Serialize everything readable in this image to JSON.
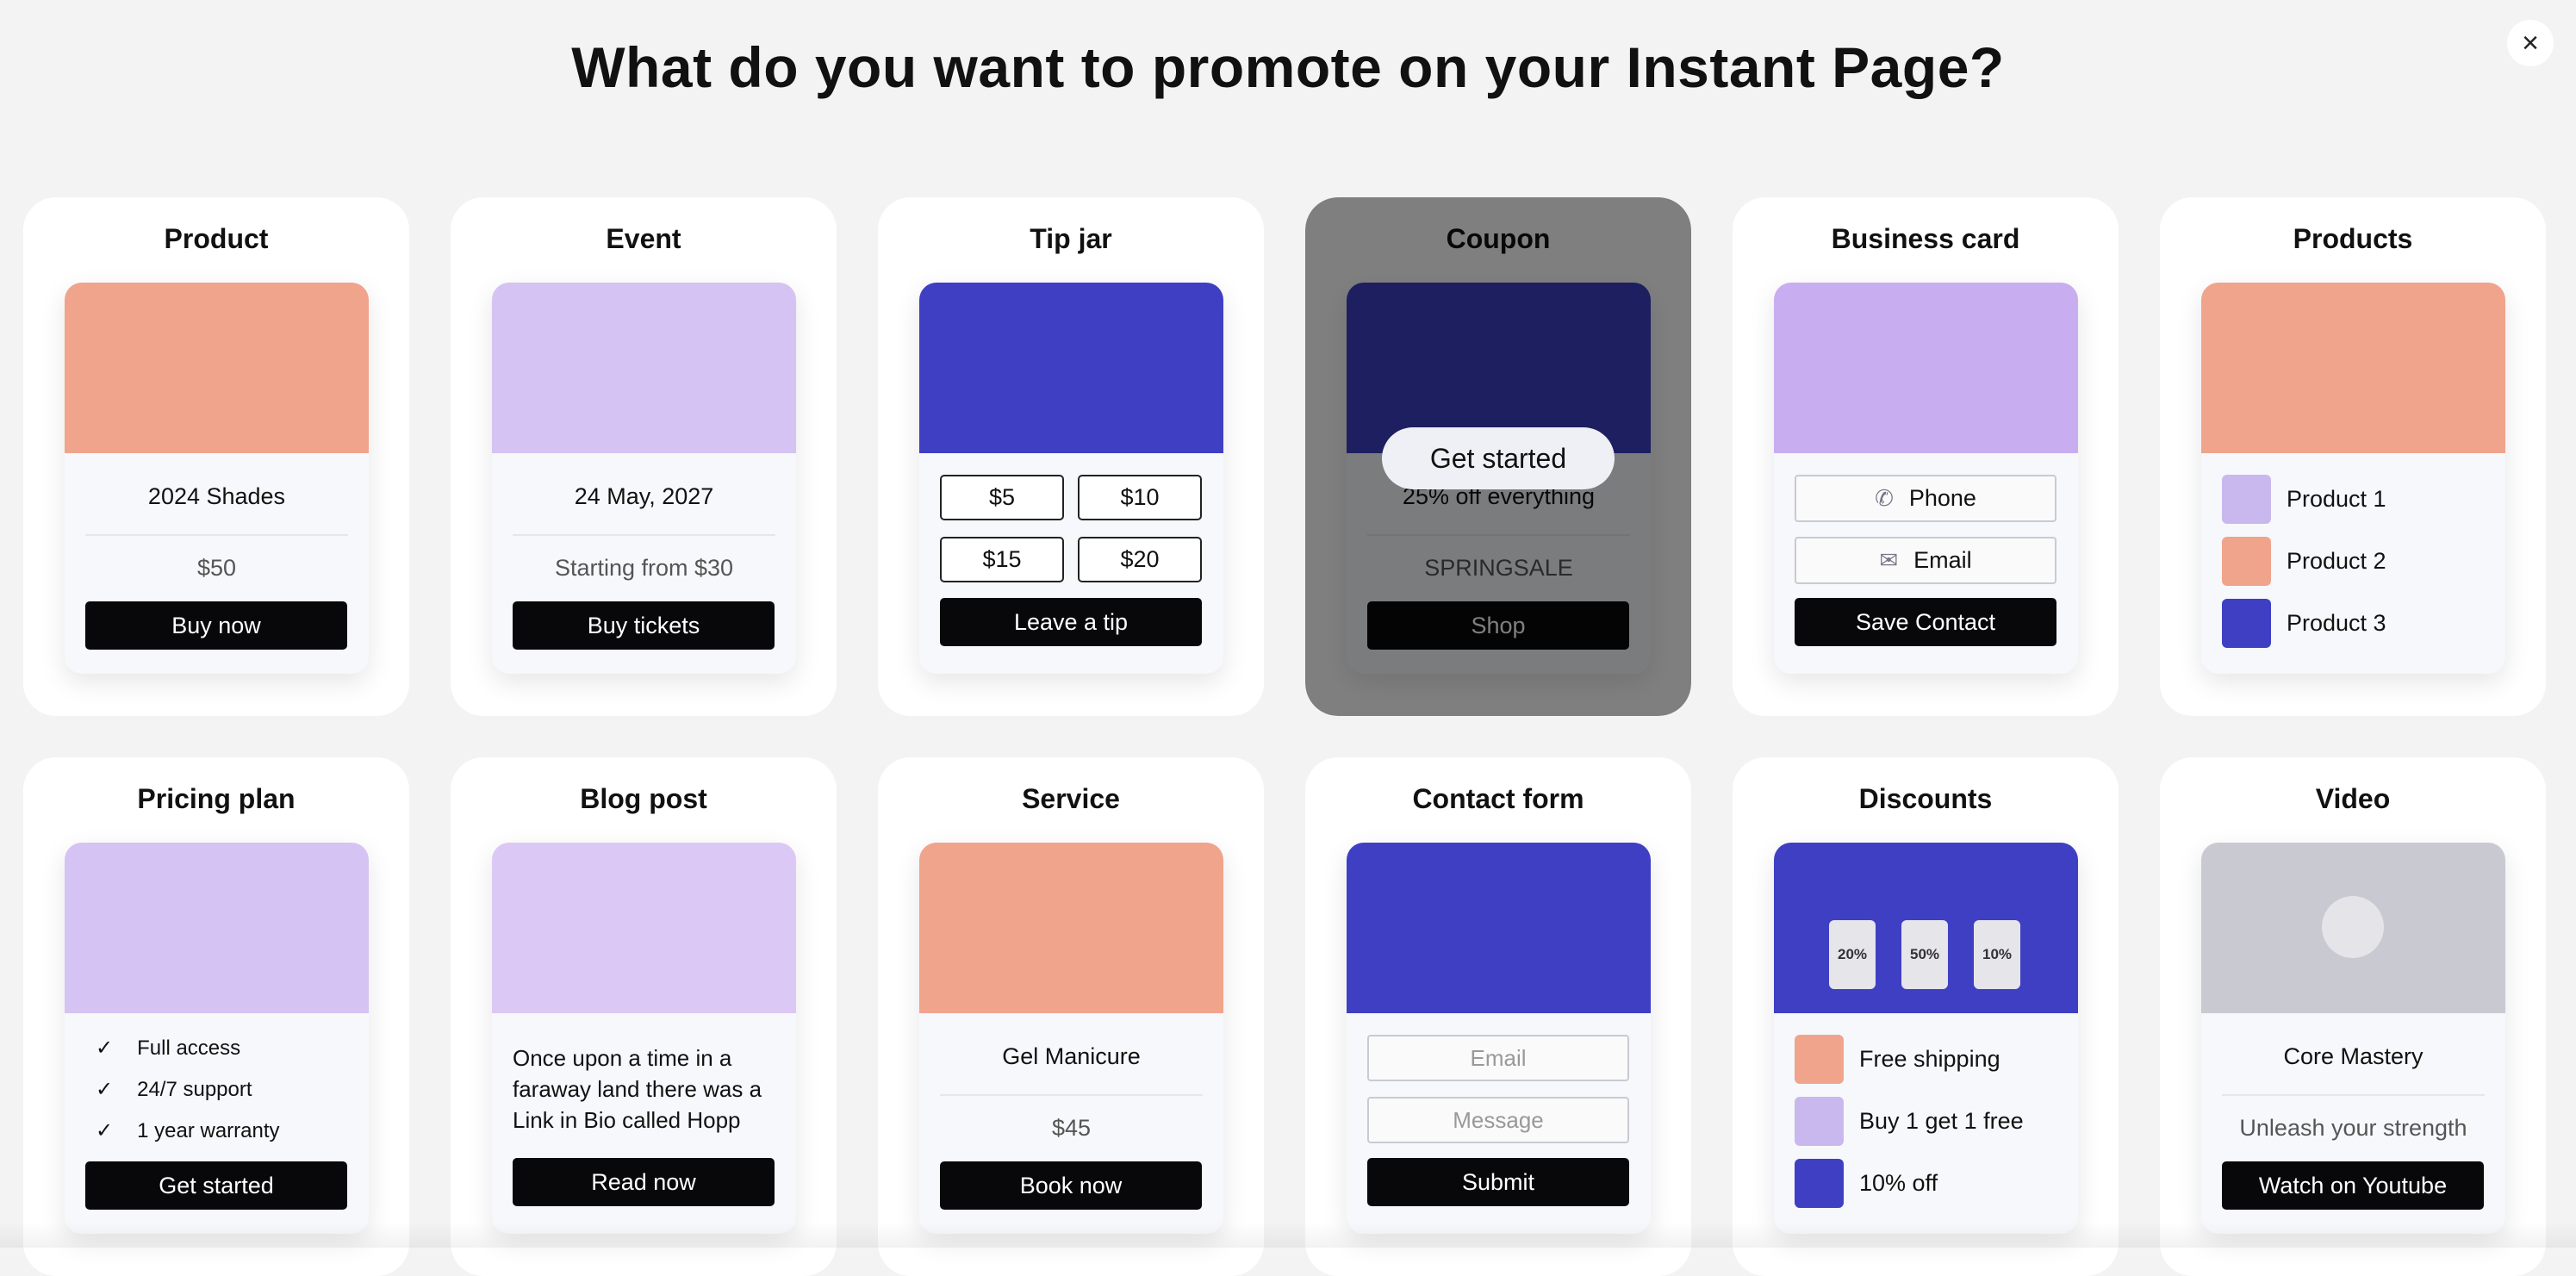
{
  "page": {
    "title": "What do you want to promote on your Instant Page?",
    "close_icon": "close-icon"
  },
  "hover_cta": "Get started",
  "tiles": [
    {
      "id": "product",
      "type": "product",
      "title": "Product",
      "image_color": "#f0a48c",
      "name": "2024 Shades",
      "price": "$50",
      "button": "Buy now"
    },
    {
      "id": "event",
      "type": "product",
      "title": "Event",
      "image_color": "#d5c3f3",
      "name": "24 May, 2027",
      "price": "Starting from $30",
      "button": "Buy tickets"
    },
    {
      "id": "tip-jar",
      "type": "options",
      "title": "Tip jar",
      "image_color": "#3f3fc4",
      "options": [
        "$5",
        "$10",
        "$15",
        "$20"
      ],
      "button": "Leave a tip"
    },
    {
      "id": "coupon",
      "type": "product",
      "title": "Coupon",
      "image_color": "#3a3fc0",
      "name": "25% off everything",
      "price": "SPRINGSALE",
      "button": "Shop",
      "hovered": true
    },
    {
      "id": "business-card",
      "type": "contact",
      "title": "Business card",
      "image_color": "#c8aef0",
      "actions": [
        {
          "label": "Phone",
          "icon": "phone-icon"
        },
        {
          "label": "Email",
          "icon": "mail-icon"
        }
      ],
      "button": "Save Contact"
    },
    {
      "id": "products",
      "type": "list",
      "title": "Products",
      "image_color": "#f0a48c",
      "items": [
        {
          "label": "Product 1",
          "color": "#c9b8ee"
        },
        {
          "label": "Product 2",
          "color": "#f0a48c"
        },
        {
          "label": "Product 3",
          "color": "#3f3fc4"
        }
      ]
    },
    {
      "id": "pricing-plan",
      "type": "checks",
      "title": "Pricing plan",
      "image_color": "#d5c3f3",
      "items": [
        "Full access",
        "24/7 support",
        "1 year warranty"
      ],
      "button": "Get started"
    },
    {
      "id": "blog-post",
      "type": "text",
      "title": "Blog post",
      "image_color": "#dcc8f5",
      "text": "Once upon a time in a faraway land there was a Link in Bio called Hopp",
      "button": "Read now"
    },
    {
      "id": "service",
      "type": "product",
      "title": "Service",
      "image_color": "#f0a48c",
      "name": "Gel Manicure",
      "price": "$45",
      "button": "Book now"
    },
    {
      "id": "contact-form",
      "type": "form",
      "title": "Contact form",
      "image_color": "#3f3fc4",
      "fields": [
        "Email",
        "Message"
      ],
      "button": "Submit"
    },
    {
      "id": "discounts",
      "type": "list",
      "title": "Discounts",
      "image_color": "#3f3fc4",
      "items": [
        {
          "label": "Free shipping",
          "color": "#f0a48c"
        },
        {
          "label": "Buy 1 get 1 free",
          "color": "#c9b8ee"
        },
        {
          "label": "10% off",
          "color": "#3f3fc4"
        }
      ],
      "tags": [
        "20%",
        "50%",
        "10%"
      ]
    },
    {
      "id": "video",
      "type": "product",
      "title": "Video",
      "image_color": "#c9c9d2",
      "name": "Core Mastery",
      "price": "Unleash your strength",
      "button": "Watch on Youtube"
    }
  ]
}
